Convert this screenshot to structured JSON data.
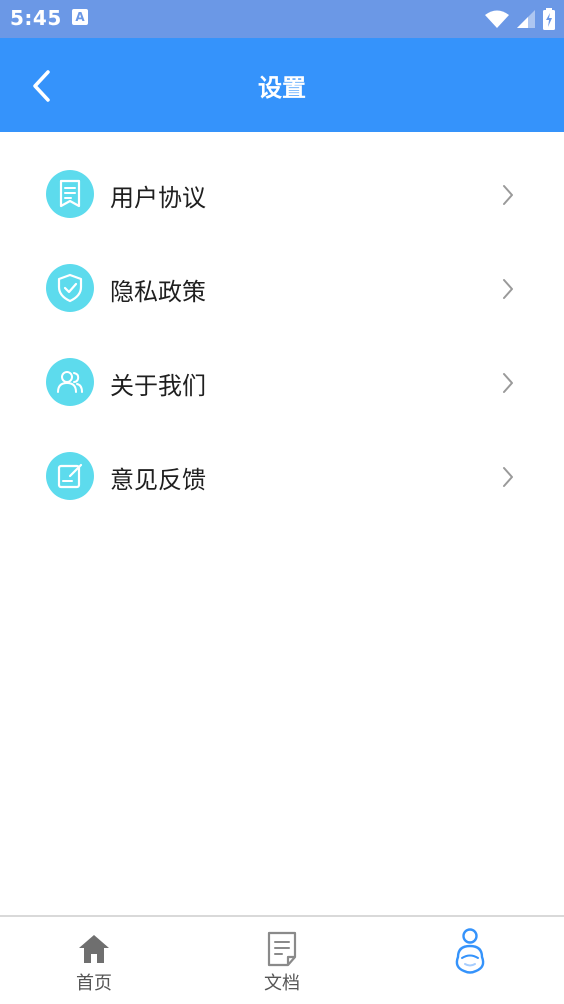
{
  "status_bar": {
    "time": "5:45",
    "badge_letter": "A",
    "icons": [
      "a-notification-icon",
      "wifi-icon",
      "cell-signal-icon",
      "battery-charging-icon"
    ]
  },
  "header": {
    "title": "设置",
    "back_icon": "chevron-left-icon",
    "background_color": "#3593fb"
  },
  "menu": {
    "items": [
      {
        "label": "用户协议",
        "icon": "document-bookmark-icon"
      },
      {
        "label": "隐私政策",
        "icon": "shield-check-icon"
      },
      {
        "label": "关于我们",
        "icon": "users-icon"
      },
      {
        "label": "意见反馈",
        "icon": "feedback-edit-icon"
      }
    ],
    "icon_color": "#5ddbed",
    "chevron_icon": "chevron-right-icon"
  },
  "bottom_nav": {
    "items": [
      {
        "label": "首页",
        "icon": "home-icon"
      },
      {
        "label": "文档",
        "icon": "document-icon"
      },
      {
        "label": "",
        "icon": "profile-avatar-icon",
        "active": true
      }
    ],
    "active_color": "#3593fb"
  }
}
